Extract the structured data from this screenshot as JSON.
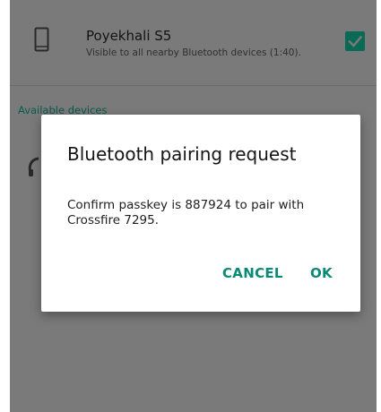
{
  "device": {
    "name": "Poyekhali S5",
    "visibility_text": "Visible to all nearby Bluetooth devices (1:40).",
    "visible_checked": true,
    "phone_icon": "phone-icon",
    "check_icon": "check-icon"
  },
  "available_devices": {
    "header": "Available devices",
    "headset_icon": "headset-icon"
  },
  "dialog": {
    "title": "Bluetooth pairing request",
    "message": "Confirm passkey is 887924 to pair with Crossfire 7295.",
    "cancel_label": "CANCEL",
    "ok_label": "OK"
  },
  "colors": {
    "scrim": "#7a7a7a",
    "accent": "#0a8a74",
    "checkbox_dimmed": "#0a6a55"
  }
}
